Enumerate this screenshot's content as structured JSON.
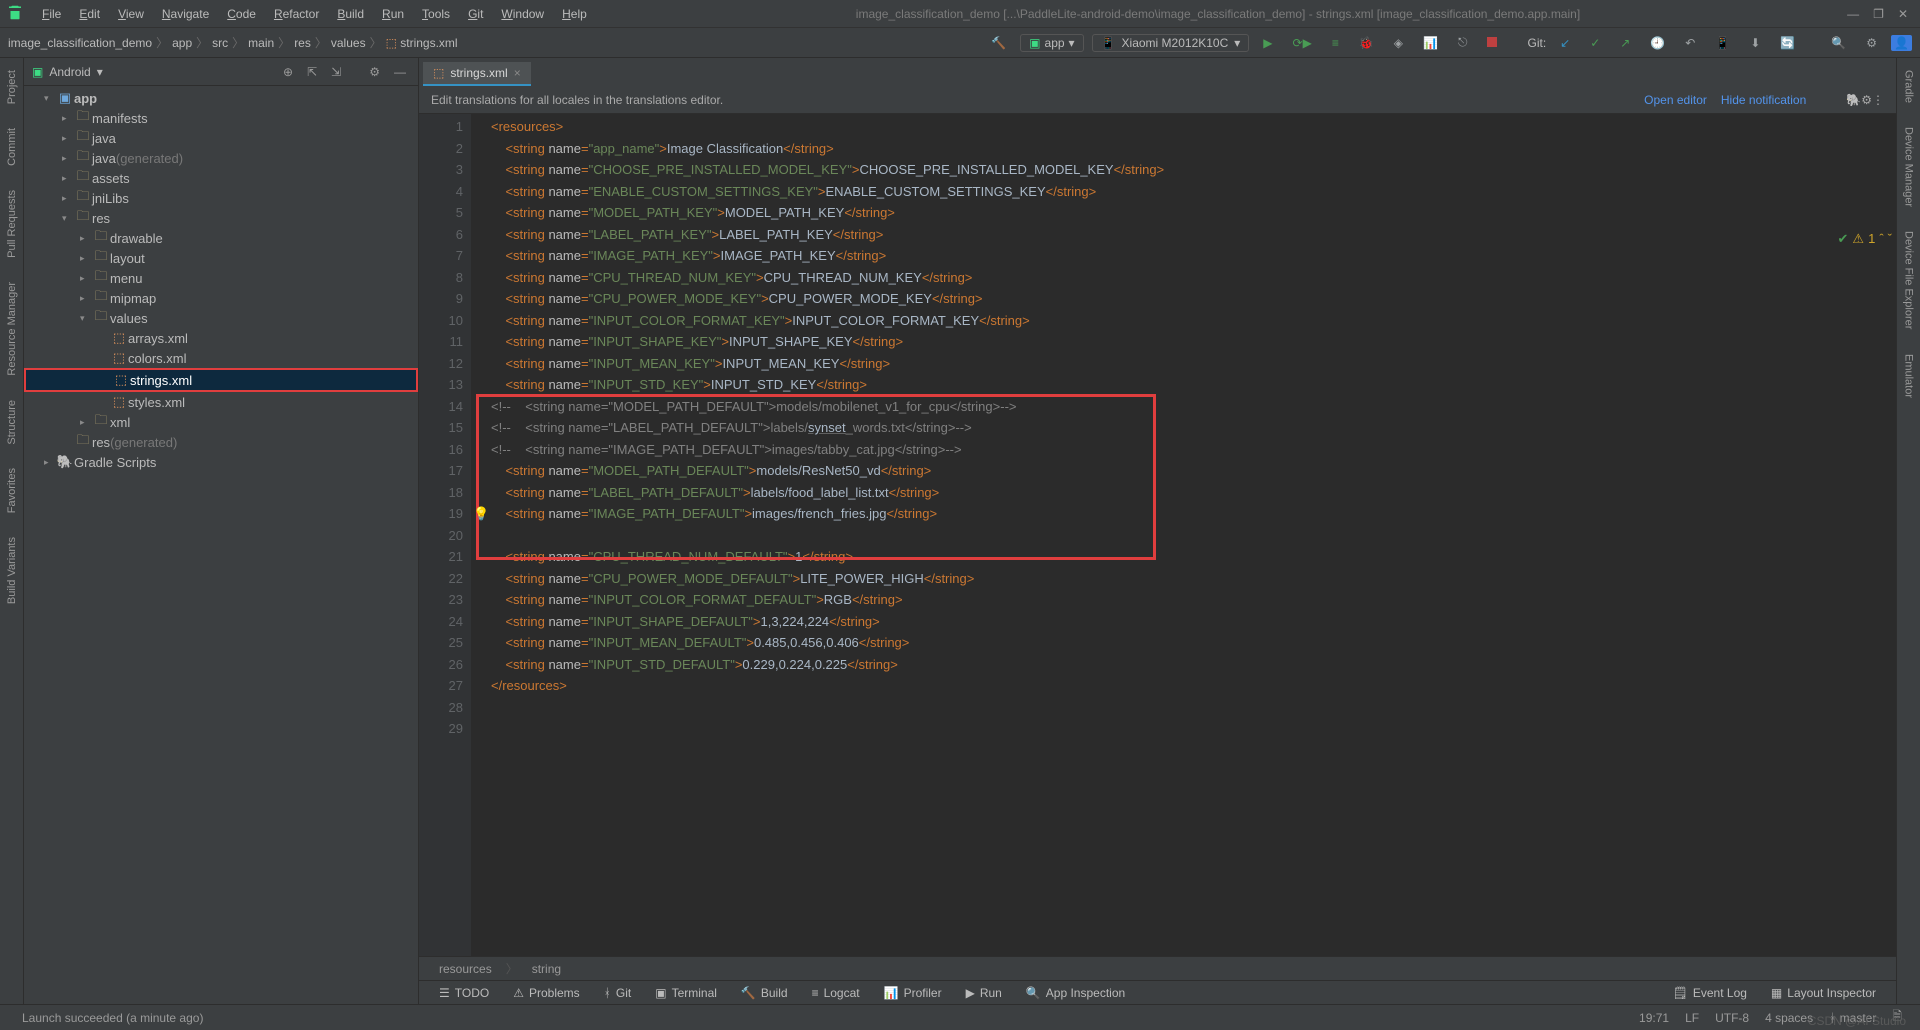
{
  "window": {
    "menus": [
      "File",
      "Edit",
      "View",
      "Navigate",
      "Code",
      "Refactor",
      "Build",
      "Run",
      "Tools",
      "Git",
      "Window",
      "Help"
    ],
    "title": "image_classification_demo [...\\PaddleLite-android-demo\\image_classification_demo] - strings.xml [image_classification_demo.app.main]"
  },
  "breadcrumb": [
    "image_classification_demo",
    "app",
    "src",
    "main",
    "res",
    "values",
    "strings.xml"
  ],
  "run_config": "app",
  "device": "Xiaomi M2012K10C",
  "git_label": "Git:",
  "project_panel": {
    "title": "Android",
    "tree": [
      {
        "label": "app",
        "depth": 0,
        "type": "module",
        "expanded": true
      },
      {
        "label": "manifests",
        "depth": 1,
        "type": "folder",
        "collapsed": true
      },
      {
        "label": "java",
        "depth": 1,
        "type": "folder",
        "collapsed": true
      },
      {
        "label": "java",
        "hint": "(generated)",
        "depth": 1,
        "type": "folder",
        "collapsed": true
      },
      {
        "label": "assets",
        "depth": 1,
        "type": "folder",
        "collapsed": true
      },
      {
        "label": "jniLibs",
        "depth": 1,
        "type": "folder",
        "collapsed": true
      },
      {
        "label": "res",
        "depth": 1,
        "type": "folder",
        "expanded": true
      },
      {
        "label": "drawable",
        "depth": 2,
        "type": "folder",
        "collapsed": true
      },
      {
        "label": "layout",
        "depth": 2,
        "type": "folder",
        "collapsed": true
      },
      {
        "label": "menu",
        "depth": 2,
        "type": "folder",
        "collapsed": true
      },
      {
        "label": "mipmap",
        "depth": 2,
        "type": "folder",
        "collapsed": true
      },
      {
        "label": "values",
        "depth": 2,
        "type": "folder",
        "expanded": true
      },
      {
        "label": "arrays.xml",
        "depth": 3,
        "type": "xml"
      },
      {
        "label": "colors.xml",
        "depth": 3,
        "type": "xml"
      },
      {
        "label": "strings.xml",
        "depth": 3,
        "type": "xml",
        "selected": true
      },
      {
        "label": "styles.xml",
        "depth": 3,
        "type": "xml"
      },
      {
        "label": "xml",
        "depth": 2,
        "type": "folder",
        "collapsed": true
      },
      {
        "label": "res",
        "hint": "(generated)",
        "depth": 1,
        "type": "folder"
      },
      {
        "label": "Gradle Scripts",
        "depth": 0,
        "type": "gradle",
        "collapsed": true
      }
    ]
  },
  "editor": {
    "tab": "strings.xml",
    "notif_msg": "Edit translations for all locales in the translations editor.",
    "notif_open": "Open editor",
    "notif_hide": "Hide notification",
    "warning_count": "1",
    "crumbs": [
      "resources",
      "string"
    ],
    "lines": [
      {
        "n": 1,
        "kind": "open",
        "text": "<resources>"
      },
      {
        "n": 2,
        "kind": "str",
        "name": "app_name",
        "value": "Image Classification"
      },
      {
        "n": 3,
        "kind": "str",
        "name": "CHOOSE_PRE_INSTALLED_MODEL_KEY",
        "value": "CHOOSE_PRE_INSTALLED_MODEL_KEY"
      },
      {
        "n": 4,
        "kind": "str",
        "name": "ENABLE_CUSTOM_SETTINGS_KEY",
        "value": "ENABLE_CUSTOM_SETTINGS_KEY"
      },
      {
        "n": 5,
        "kind": "str",
        "name": "MODEL_PATH_KEY",
        "value": "MODEL_PATH_KEY"
      },
      {
        "n": 6,
        "kind": "str",
        "name": "LABEL_PATH_KEY",
        "value": "LABEL_PATH_KEY"
      },
      {
        "n": 7,
        "kind": "str",
        "name": "IMAGE_PATH_KEY",
        "value": "IMAGE_PATH_KEY"
      },
      {
        "n": 8,
        "kind": "str",
        "name": "CPU_THREAD_NUM_KEY",
        "value": "CPU_THREAD_NUM_KEY"
      },
      {
        "n": 9,
        "kind": "str",
        "name": "CPU_POWER_MODE_KEY",
        "value": "CPU_POWER_MODE_KEY"
      },
      {
        "n": 10,
        "kind": "str",
        "name": "INPUT_COLOR_FORMAT_KEY",
        "value": "INPUT_COLOR_FORMAT_KEY"
      },
      {
        "n": 11,
        "kind": "str",
        "name": "INPUT_SHAPE_KEY",
        "value": "INPUT_SHAPE_KEY"
      },
      {
        "n": 12,
        "kind": "str",
        "name": "INPUT_MEAN_KEY",
        "value": "INPUT_MEAN_KEY"
      },
      {
        "n": 13,
        "kind": "str",
        "name": "INPUT_STD_KEY",
        "value": "INPUT_STD_KEY"
      },
      {
        "n": 14,
        "kind": "cmt",
        "name": "MODEL_PATH_DEFAULT",
        "value": "models/mobilenet_v1_for_cpu"
      },
      {
        "n": 15,
        "kind": "cmt",
        "name": "LABEL_PATH_DEFAULT",
        "value": "labels/synset_words.txt",
        "under": true
      },
      {
        "n": 16,
        "kind": "cmt",
        "name": "IMAGE_PATH_DEFAULT",
        "value": "images/tabby_cat.jpg"
      },
      {
        "n": 17,
        "kind": "str",
        "name": "MODEL_PATH_DEFAULT",
        "value": "models/ResNet50_vd"
      },
      {
        "n": 18,
        "kind": "str",
        "name": "LABEL_PATH_DEFAULT",
        "value": "labels/food_label_list.txt"
      },
      {
        "n": 19,
        "kind": "str",
        "name": "IMAGE_PATH_DEFAULT",
        "value": "images/french_fries.jpg",
        "bulb": true
      },
      {
        "n": 20,
        "kind": "blank"
      },
      {
        "n": 21,
        "kind": "str",
        "name": "CPU_THREAD_NUM_DEFAULT",
        "value": "1"
      },
      {
        "n": 22,
        "kind": "str",
        "name": "CPU_POWER_MODE_DEFAULT",
        "value": "LITE_POWER_HIGH"
      },
      {
        "n": 23,
        "kind": "str",
        "name": "INPUT_COLOR_FORMAT_DEFAULT",
        "value": "RGB"
      },
      {
        "n": 24,
        "kind": "str",
        "name": "INPUT_SHAPE_DEFAULT",
        "value": "1,3,224,224"
      },
      {
        "n": 25,
        "kind": "str",
        "name": "INPUT_MEAN_DEFAULT",
        "value": "0.485,0.456,0.406"
      },
      {
        "n": 26,
        "kind": "str",
        "name": "INPUT_STD_DEFAULT",
        "value": "0.229,0.224,0.225"
      },
      {
        "n": 27,
        "kind": "close",
        "text": "</resources>"
      },
      {
        "n": 28,
        "kind": "blank"
      },
      {
        "n": 29,
        "kind": "blank"
      }
    ]
  },
  "toolstrip": [
    "TODO",
    "Problems",
    "Git",
    "Terminal",
    "Build",
    "Logcat",
    "Profiler",
    "Run",
    "App Inspection"
  ],
  "toolstrip_right": [
    "Event Log",
    "Layout Inspector"
  ],
  "status": {
    "msg": "Launch succeeded (a minute ago)",
    "pos": "19:71",
    "eol": "LF",
    "enc": "UTF-8",
    "indent": "4 spaces",
    "branch": "master",
    "watermark": "CSDN @AI Studio"
  },
  "rails": {
    "left": [
      "Project",
      "Commit",
      "Pull Requests",
      "Resource Manager",
      "Structure",
      "Favorites",
      "Build Variants"
    ],
    "right": [
      "Gradle",
      "Device Manager",
      "Device File Explorer",
      "Emulator"
    ]
  }
}
